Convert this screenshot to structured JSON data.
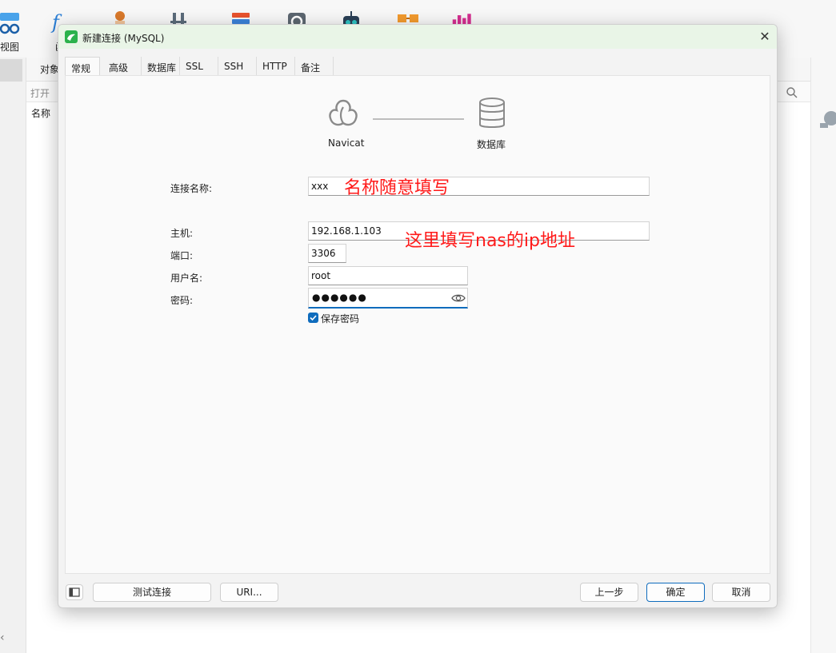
{
  "background": {
    "toolbar": {
      "view_label": "视图",
      "func_partial": "函",
      "icons": [
        "view-icon",
        "function-icon",
        "user-icon",
        "tools-icon",
        "query-icon",
        "backup-icon",
        "robot-icon",
        "model-icon",
        "chart-icon"
      ]
    },
    "tab_partial": "对象",
    "open_partial": "打开",
    "name_header": "名称",
    "chevron": "‹"
  },
  "dialog": {
    "title": "新建连接 (MySQL)",
    "close_glyph": "✕",
    "tabs": [
      {
        "label": "常规"
      },
      {
        "label": "高级"
      },
      {
        "label": "数据库"
      },
      {
        "label": "SSL"
      },
      {
        "label": "SSH"
      },
      {
        "label": "HTTP"
      },
      {
        "label": "备注"
      }
    ],
    "diagram": {
      "left_label": "Navicat",
      "right_label": "数据库"
    },
    "form": {
      "connection_name": {
        "label": "连接名称:",
        "value": "xxx"
      },
      "host": {
        "label": "主机:",
        "value": "192.168.1.103"
      },
      "port": {
        "label": "端口:",
        "value": "3306"
      },
      "username": {
        "label": "用户名:",
        "value": "root"
      },
      "password": {
        "label": "密码:",
        "masked": "●●●●●●"
      },
      "save_password": {
        "label": "保存密码",
        "checked": true
      }
    },
    "annotations": {
      "name_note": "名称随意填写",
      "host_note": "这里填写nas的ip地址"
    },
    "footer": {
      "test_connection": "测试连接",
      "uri": "URI...",
      "previous": "上一步",
      "ok": "确定",
      "cancel": "取消"
    }
  },
  "colors": {
    "accent": "#0f6cbd",
    "annotation": "#ff1a1a",
    "titlebar": "#e9f5e7",
    "brand_green": "#2bb24c"
  }
}
